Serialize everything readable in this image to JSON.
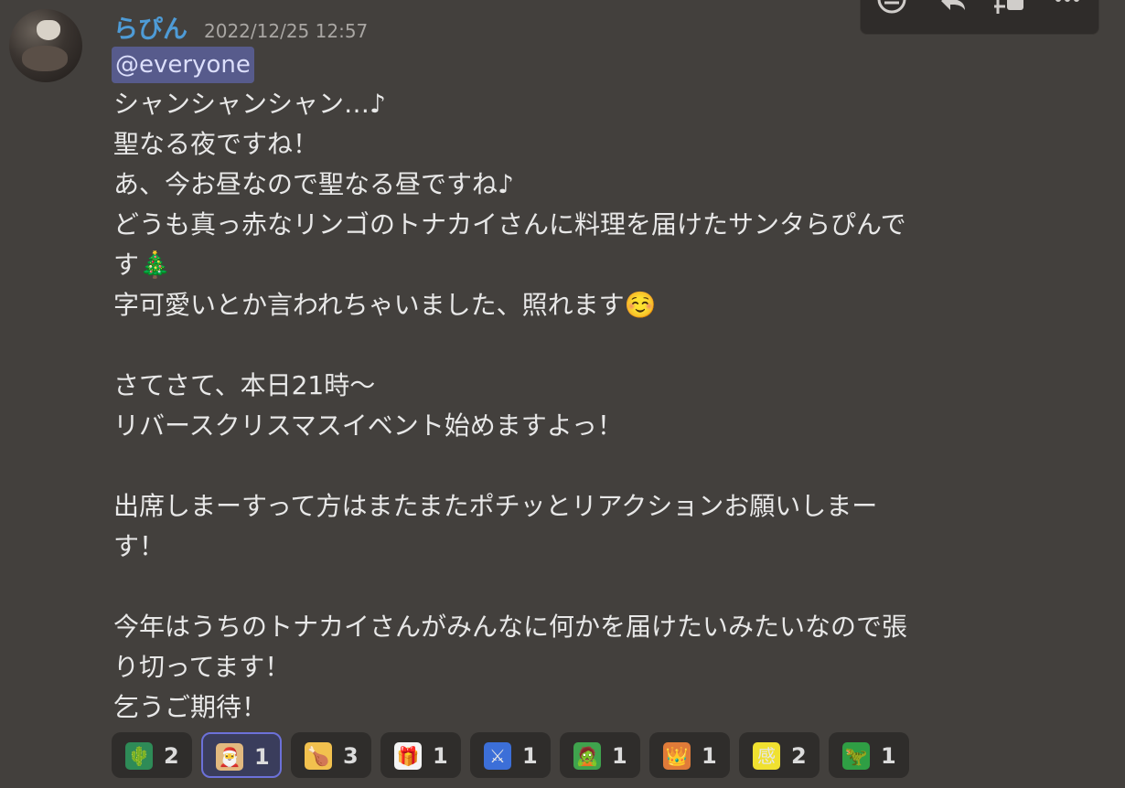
{
  "author": {
    "username": "らぴん",
    "timestamp": "2022/12/25 12:57"
  },
  "mention": "@everyone",
  "message": {
    "text": "シャンシャンシャン…♪\n聖なる夜ですね！\nあ、今お昼なので聖なる昼ですね♪\nどうも真っ赤なリンゴのトナカイさんに料理を届けたサンタらぴんで\nす🎄\n字可愛いとか言われちゃいました、照れます☺️\n\nさてさて、本日21時〜\nリバースクリスマスイベント始めますよっ！\n\n出席しまーすって方はまたまたポチッとリアクションお願いしまー\nす！\n\n今年はうちのトナカイさんがみんなに何かを届けたいみたいなので張\nり切ってます！\n乞うご期待！"
  },
  "toolbar": {
    "icons": [
      "add-reaction-icon",
      "reply-icon",
      "create-thread-icon",
      "more-icon"
    ]
  },
  "reactions": [
    {
      "name": "cactus-emoji",
      "count": "2",
      "color": "#2e8b57",
      "glyph": "🌵",
      "active": false
    },
    {
      "name": "santa-emoji",
      "count": "1",
      "color": "#e2b97f",
      "glyph": "🎅",
      "active": true
    },
    {
      "name": "custom-emoji-a",
      "count": "3",
      "color": "#f2c14e",
      "glyph": "🍗",
      "active": false
    },
    {
      "name": "custom-emoji-b",
      "count": "1",
      "color": "#f4f4f4",
      "glyph": "🎁",
      "active": false
    },
    {
      "name": "custom-emoji-c",
      "count": "1",
      "color": "#3c6fd8",
      "glyph": "⚔",
      "active": false
    },
    {
      "name": "custom-emoji-d",
      "count": "1",
      "color": "#3fa34d",
      "glyph": "🧟",
      "active": false
    },
    {
      "name": "custom-emoji-e",
      "count": "1",
      "color": "#e07b39",
      "glyph": "👑",
      "active": false
    },
    {
      "name": "kansha-emoji",
      "count": "2",
      "color": "#f0e130",
      "glyph": "感",
      "active": false
    },
    {
      "name": "custom-emoji-f",
      "count": "1",
      "color": "#2f9e44",
      "glyph": "🦖",
      "active": false
    }
  ]
}
